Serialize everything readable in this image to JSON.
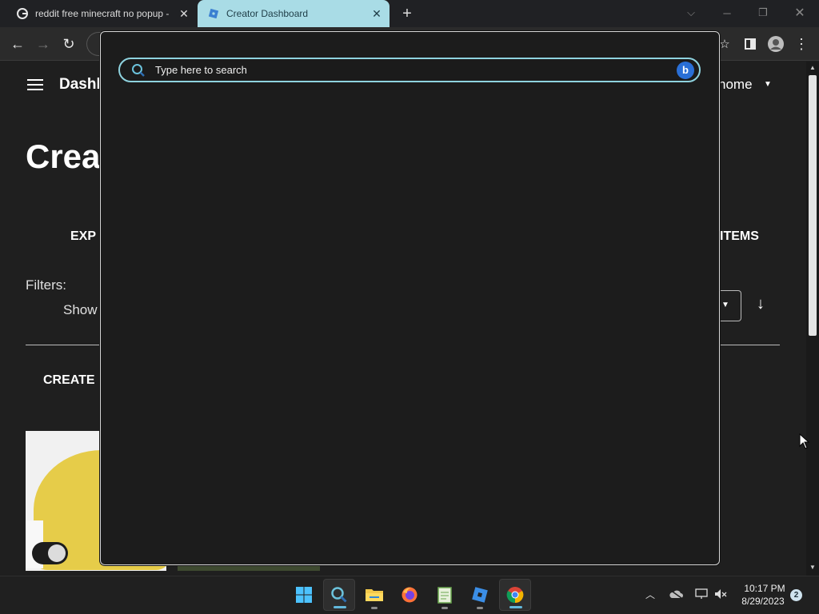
{
  "browser": {
    "tabs": [
      {
        "title": "reddit free minecraft no popup -",
        "icon": "google-icon",
        "active": false
      },
      {
        "title": "Creator Dashboard",
        "icon": "roblox-icon",
        "active": true
      }
    ],
    "new_tab_label": "+",
    "close_label": "✕"
  },
  "page": {
    "header_title": "Dashb",
    "nav_home": "home",
    "heading": "Crea",
    "tab_experiences": "EXP",
    "tab_items": "ITEMS",
    "filters_label": "Filters:",
    "show_label": "Show",
    "create_label": "CREATE"
  },
  "search": {
    "placeholder": "Type here to search",
    "value": ""
  },
  "taskbar": {
    "apps": [
      "windows-start-icon",
      "search-icon",
      "file-explorer-icon",
      "firefox-icon",
      "notepad-icon",
      "roblox-studio-icon",
      "chrome-icon"
    ],
    "clock_time": "10:17 PM",
    "clock_date": "8/29/2023",
    "notification_count": "2"
  },
  "colors": {
    "active_tab": "#a9dce6",
    "search_border": "#8fd3df",
    "accent": "#62b8dc"
  }
}
